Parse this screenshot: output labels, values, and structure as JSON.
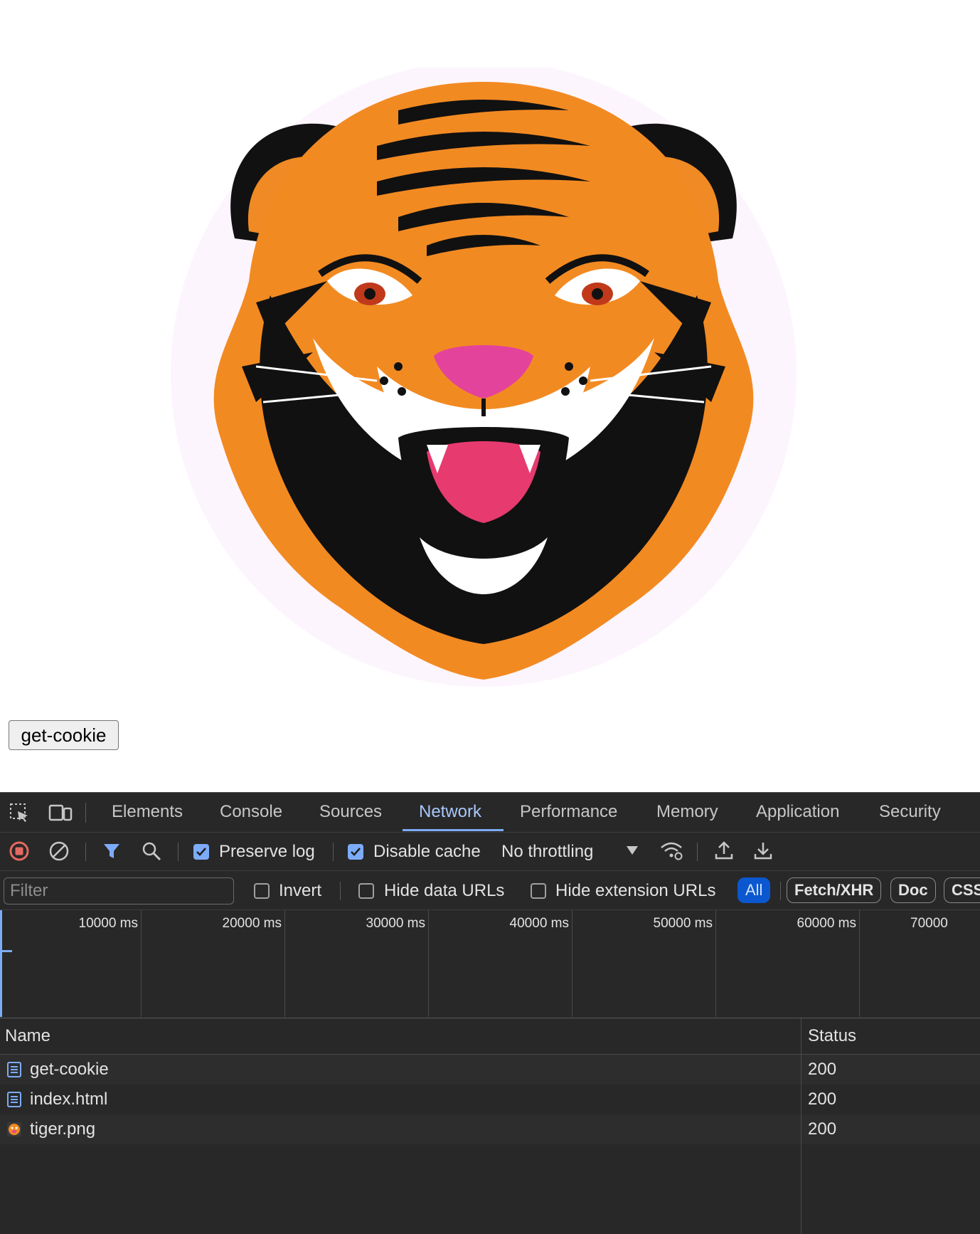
{
  "page": {
    "image_alt": "Tiger head illustration",
    "button_label": "get-cookie"
  },
  "devtools": {
    "tabs": [
      "Elements",
      "Console",
      "Sources",
      "Network",
      "Performance",
      "Memory",
      "Application",
      "Security"
    ],
    "active_tab": "Network",
    "toolbar": {
      "preserve_log_label": "Preserve log",
      "preserve_log_checked": true,
      "disable_cache_label": "Disable cache",
      "disable_cache_checked": true,
      "throttling_value": "No throttling"
    },
    "filter": {
      "placeholder": "Filter",
      "invert_label": "Invert",
      "hide_data_urls_label": "Hide data URLs",
      "hide_extension_urls_label": "Hide extension URLs",
      "chips": [
        "All",
        "Fetch/XHR",
        "Doc",
        "CSS"
      ],
      "active_chip": "All"
    },
    "timeline": {
      "ticks": [
        "10000 ms",
        "20000 ms",
        "30000 ms",
        "40000 ms",
        "50000 ms",
        "60000 ms",
        "70000"
      ]
    },
    "table": {
      "columns": [
        "Name",
        "Status"
      ],
      "rows": [
        {
          "name": "get-cookie",
          "status": "200",
          "icon": "document-icon"
        },
        {
          "name": "index.html",
          "status": "200",
          "icon": "document-icon"
        },
        {
          "name": "tiger.png",
          "status": "200",
          "icon": "image-thumbnail-icon"
        }
      ]
    },
    "colors": {
      "background": "#282828",
      "accent": "#7cacf8",
      "record_stop": "#e46962"
    }
  }
}
